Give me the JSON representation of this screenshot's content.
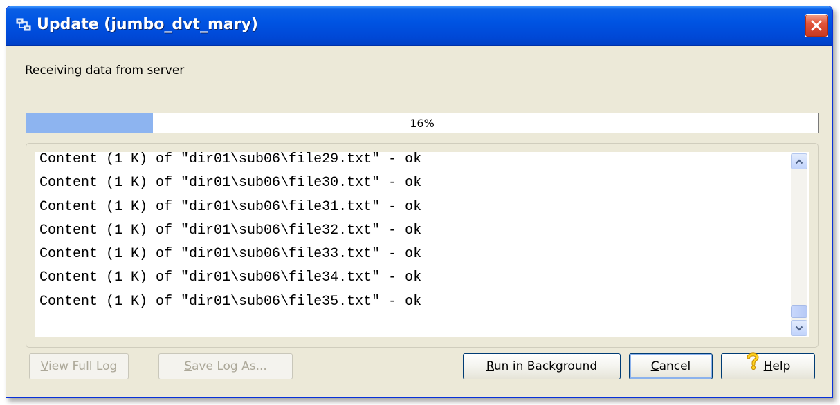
{
  "window": {
    "title": "Update (jumbo_dvt_mary)",
    "icon": "network-update-icon",
    "close_icon": "close-icon"
  },
  "status": {
    "label": "Receiving data from server"
  },
  "progress": {
    "value": 0.16,
    "text": "16%",
    "fill_color": "#8db4f0"
  },
  "log": {
    "lines": [
      "Content (1 K) of \"dir01\\sub06\\file29.txt\" - ok",
      "Content (1 K) of \"dir01\\sub06\\file30.txt\" - ok",
      "Content (1 K) of \"dir01\\sub06\\file31.txt\" - ok",
      "Content (1 K) of \"dir01\\sub06\\file32.txt\" - ok",
      "Content (1 K) of \"dir01\\sub06\\file33.txt\" - ok",
      "Content (1 K) of \"dir01\\sub06\\file34.txt\" - ok",
      "Content (1 K) of \"dir01\\sub06\\file35.txt\" - ok"
    ]
  },
  "buttons": {
    "view_full_log": {
      "pre": "",
      "u": "V",
      "post": "iew Full Log",
      "enabled": false
    },
    "save_log_as": {
      "pre": "",
      "u": "S",
      "post": "ave Log As...",
      "enabled": false
    },
    "run_in_background": {
      "pre": "",
      "u": "R",
      "post": "un in Background",
      "enabled": true
    },
    "cancel": {
      "pre": "",
      "u": "C",
      "post": "ancel",
      "enabled": true
    },
    "help": {
      "pre": "",
      "u": "H",
      "post": "elp",
      "icon": "question-mark-icon",
      "enabled": true
    }
  },
  "colors": {
    "title_bar": "#0054e3",
    "window_bg": "#ece9d8",
    "close_button": "#e2553b",
    "disabled_text": "#aca899"
  }
}
